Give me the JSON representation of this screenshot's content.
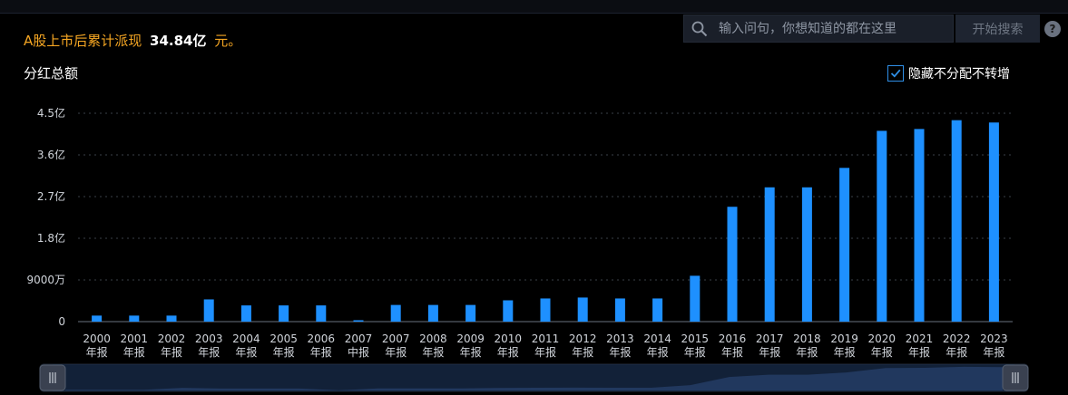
{
  "header": {
    "summary_prefix": "A股上市后累计派现",
    "summary_amount": "34.84亿",
    "summary_suffix": "元。",
    "chart_title": "分红总额"
  },
  "search": {
    "placeholder": "输入问句，你想知道的都在这里",
    "button_label": "开始搜索",
    "icon": "search-icon",
    "help_icon": "help-icon",
    "help_glyph": "?"
  },
  "toggle": {
    "label": "隐藏不分配不转增",
    "checked": true
  },
  "colors": {
    "bar": "#1e90ff",
    "accent": "#f5a623",
    "grid": "#3a3f48",
    "axis": "#6a7280"
  },
  "chart_data": {
    "type": "bar",
    "categories": [
      "2000年报",
      "2001年报",
      "2002年报",
      "2003年报",
      "2004年报",
      "2005年报",
      "2006年报",
      "2007中报",
      "2007年报",
      "2008年报",
      "2009年报",
      "2010年报",
      "2011年报",
      "2012年报",
      "2013年报",
      "2014年报",
      "2015年报",
      "2016年报",
      "2017年报",
      "2018年报",
      "2019年报",
      "2020年报",
      "2021年报",
      "2022年报",
      "2023年报"
    ],
    "category_lines": [
      [
        "2000",
        "年报"
      ],
      [
        "2001",
        "年报"
      ],
      [
        "2002",
        "年报"
      ],
      [
        "2003",
        "年报"
      ],
      [
        "2004",
        "年报"
      ],
      [
        "2005",
        "年报"
      ],
      [
        "2006",
        "年报"
      ],
      [
        "2007",
        "中报"
      ],
      [
        "2007",
        "年报"
      ],
      [
        "2008",
        "年报"
      ],
      [
        "2009",
        "年报"
      ],
      [
        "2010",
        "年报"
      ],
      [
        "2011",
        "年报"
      ],
      [
        "2012",
        "年报"
      ],
      [
        "2013",
        "年报"
      ],
      [
        "2014",
        "年报"
      ],
      [
        "2015",
        "年报"
      ],
      [
        "2016",
        "年报"
      ],
      [
        "2017",
        "年报"
      ],
      [
        "2018",
        "年报"
      ],
      [
        "2019",
        "年报"
      ],
      [
        "2020",
        "年报"
      ],
      [
        "2021",
        "年报"
      ],
      [
        "2022",
        "年报"
      ],
      [
        "2023",
        "年报"
      ]
    ],
    "values": [
      0.13,
      0.13,
      0.13,
      0.48,
      0.35,
      0.35,
      0.35,
      0.03,
      0.36,
      0.36,
      0.36,
      0.46,
      0.5,
      0.52,
      0.5,
      0.5,
      0.99,
      2.48,
      2.9,
      2.9,
      3.32,
      4.12,
      4.16,
      4.35,
      4.3
    ],
    "unit": "亿元",
    "title": "分红总额",
    "xlabel": "",
    "ylabel": "",
    "ylim": [
      0,
      4.5
    ],
    "yticks": [
      0,
      0.9,
      1.8,
      2.7,
      3.6,
      4.5
    ],
    "ytick_labels": [
      "0",
      "9000万",
      "1.8亿",
      "2.7亿",
      "3.6亿",
      "4.5亿"
    ],
    "grid": true,
    "legend": "none"
  }
}
